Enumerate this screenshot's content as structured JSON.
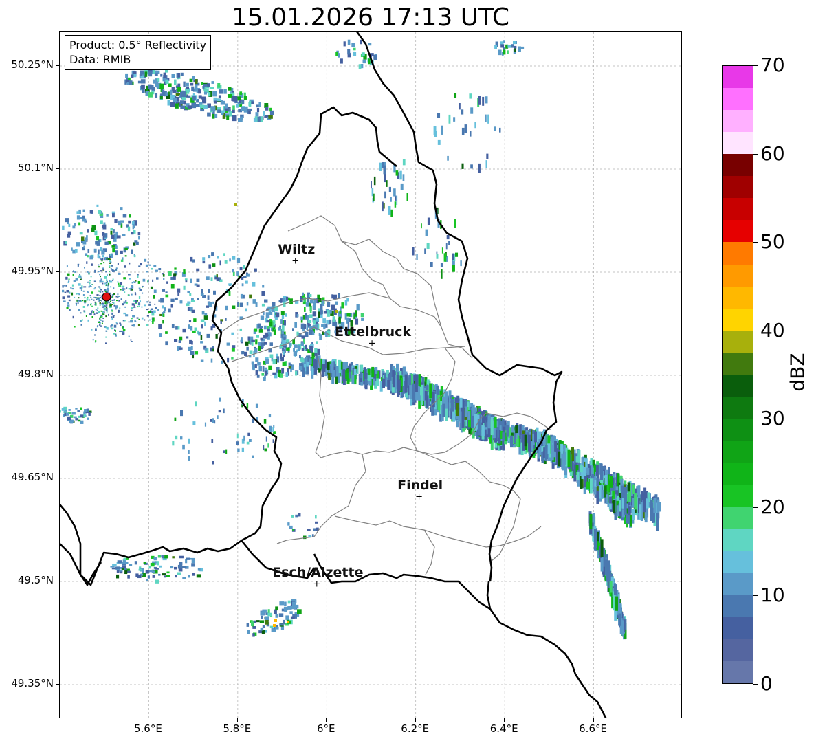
{
  "title": "15.01.2026 17:13 UTC",
  "info": {
    "product": "Product: 0.5° Reflectivity",
    "data": "Data: RMIB"
  },
  "map": {
    "lon_range": [
      5.4,
      6.8
    ],
    "lat_range": [
      49.3,
      50.3
    ],
    "lat_ticks": [
      "50.25°N",
      "50.1°N",
      "49.95°N",
      "49.8°N",
      "49.65°N",
      "49.5°N",
      "49.35°N"
    ],
    "lat_tick_values": [
      50.25,
      50.1,
      49.95,
      49.8,
      49.65,
      49.5,
      49.35
    ],
    "lon_ticks": [
      "5.6°E",
      "5.8°E",
      "6°E",
      "6.2°E",
      "6.4°E",
      "6.6°E"
    ],
    "lon_tick_values": [
      5.6,
      5.8,
      6.0,
      6.2,
      6.4,
      6.6
    ],
    "grid": true,
    "cities": [
      {
        "name": "Wiltz",
        "lon": 5.932,
        "lat": 49.967
      },
      {
        "name": "Ettelbruck",
        "lon": 6.104,
        "lat": 49.847
      },
      {
        "name": "Findel",
        "lon": 6.21,
        "lat": 49.624
      },
      {
        "name": "Esch/Alzette",
        "lon": 5.98,
        "lat": 49.497
      }
    ],
    "radar_site": {
      "lon": 5.505,
      "lat": 49.914
    },
    "colors": {
      "border": "#000000",
      "cantons": "#808080",
      "grid": "#b0b0b0",
      "radar_site": "#e01010"
    }
  },
  "colorbar": {
    "label": "dBZ",
    "ticks": [
      "0",
      "10",
      "20",
      "30",
      "40",
      "50",
      "60",
      "70"
    ],
    "range": [
      0,
      70
    ],
    "colors": [
      "#6677aa",
      "#5566a0",
      "#4560a0",
      "#4a78b0",
      "#5a9ac8",
      "#66c0dc",
      "#5fd6c2",
      "#40d470",
      "#18c424",
      "#10b418",
      "#10a416",
      "#0e9014",
      "#0e7a10",
      "#0a5e0c",
      "#417a0e",
      "#a8b00c",
      "#ffd400",
      "#ffb800",
      "#ff9a00",
      "#ff7a00",
      "#e60000",
      "#c80000",
      "#a00000",
      "#780000",
      "#ffe4ff",
      "#ffb0ff",
      "#ff70ff",
      "#e838e8"
    ]
  }
}
